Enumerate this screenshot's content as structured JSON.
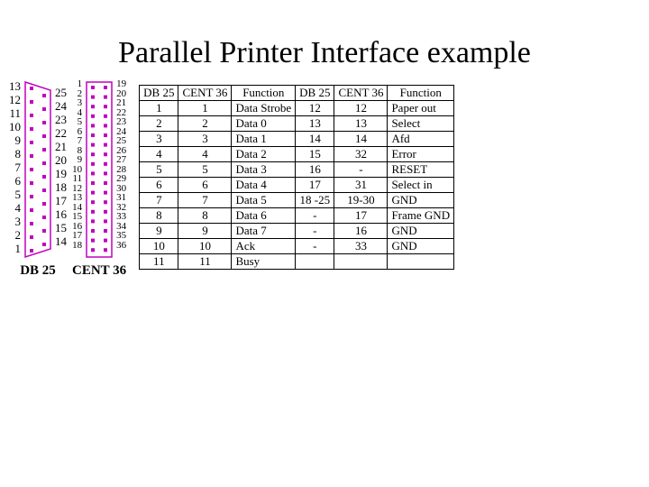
{
  "title": "Parallel Printer Interface example",
  "db25": {
    "label": "DB 25",
    "left_pins": [
      "13",
      "12",
      "11",
      "10",
      "9",
      "8",
      "7",
      "6",
      "5",
      "4",
      "3",
      "2",
      "1"
    ],
    "right_pins": [
      "25",
      "24",
      "23",
      "22",
      "21",
      "20",
      "19",
      "18",
      "17",
      "16",
      "15",
      "14"
    ]
  },
  "cent36": {
    "label": "CENT 36",
    "left_pins": [
      "1",
      "2",
      "3",
      "4",
      "5",
      "6",
      "7",
      "8",
      "9",
      "10",
      "11",
      "12",
      "13",
      "14",
      "15",
      "16",
      "17",
      "18"
    ],
    "right_pins": [
      "19",
      "20",
      "21",
      "22",
      "23",
      "24",
      "25",
      "26",
      "27",
      "28",
      "29",
      "30",
      "31",
      "32",
      "33",
      "34",
      "35",
      "36"
    ]
  },
  "table": {
    "headers": [
      "DB 25",
      "CENT 36",
      "Function",
      "DB 25",
      "CENT 36",
      "Function"
    ],
    "rows": [
      [
        "1",
        "1",
        "Data Strobe",
        "12",
        "12",
        "Paper out"
      ],
      [
        "2",
        "2",
        "Data 0",
        "13",
        "13",
        "Select"
      ],
      [
        "3",
        "3",
        "Data 1",
        "14",
        "14",
        "Afd"
      ],
      [
        "4",
        "4",
        "Data 2",
        "15",
        "32",
        "Error"
      ],
      [
        "5",
        "5",
        "Data 3",
        "16",
        "-",
        "RESET"
      ],
      [
        "6",
        "6",
        "Data 4",
        "17",
        "31",
        "Select in"
      ],
      [
        "7",
        "7",
        "Data 5",
        "18 -25",
        "19-30",
        "GND"
      ],
      [
        "8",
        "8",
        "Data 6",
        "-",
        "17",
        "Frame GND"
      ],
      [
        "9",
        "9",
        "Data 7",
        "-",
        "16",
        "GND"
      ],
      [
        "10",
        "10",
        "Ack",
        "-",
        "33",
        "GND"
      ],
      [
        "11",
        "11",
        "Busy",
        "",
        "",
        ""
      ]
    ]
  },
  "colors": {
    "connector": "#c000c0"
  }
}
